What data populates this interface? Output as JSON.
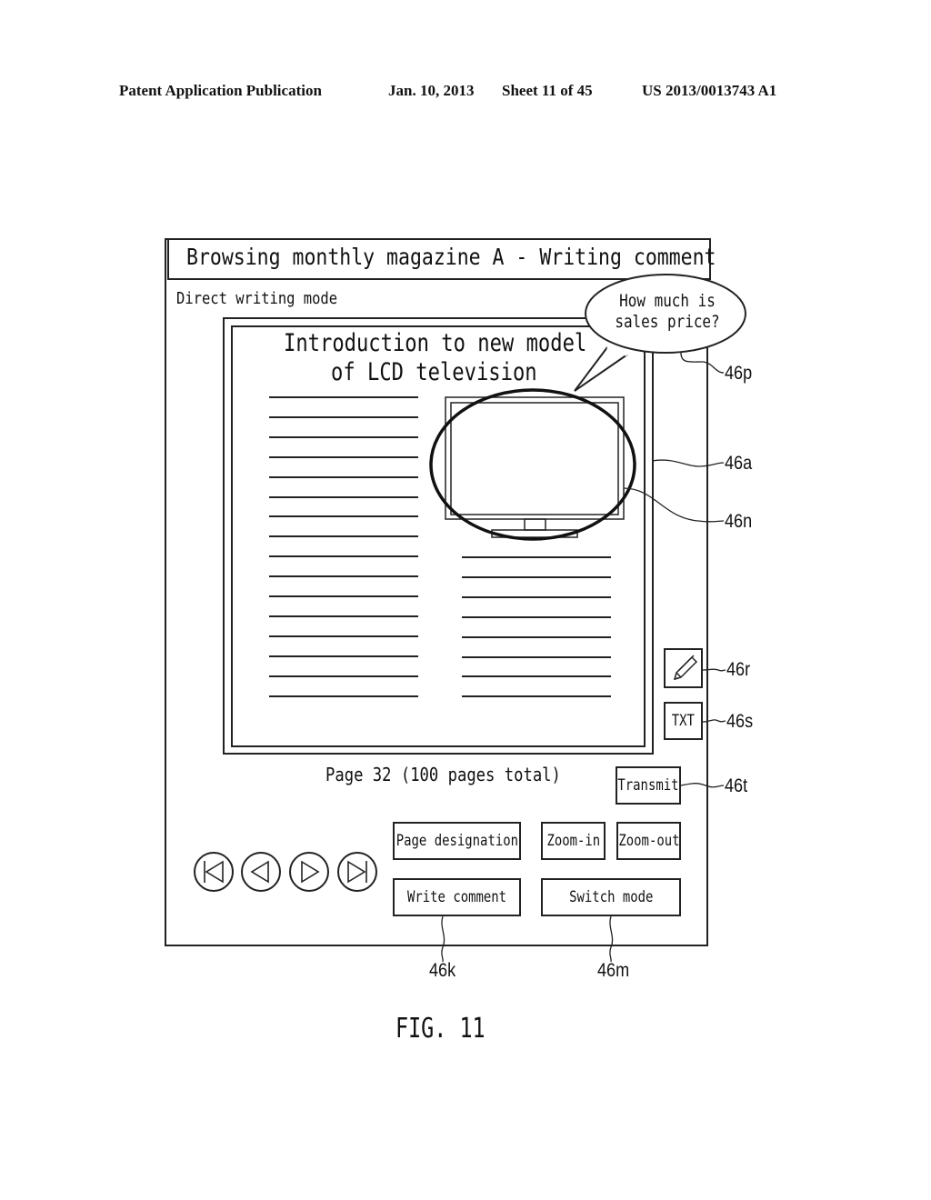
{
  "patent_header": {
    "publication": "Patent Application Publication",
    "date": "Jan. 10, 2013",
    "sheet": "Sheet 11 of 45",
    "number": "US 2013/0013743 A1"
  },
  "screen": {
    "title": "Browsing monthly magazine A - Writing comment",
    "mode_label": "Direct writing mode",
    "page": {
      "headline_line1": "Introduction to new model",
      "headline_line2": "of LCD television",
      "image": "lcd-television",
      "left_column_lines": 16,
      "right_column_lines": 8
    },
    "comment_bubble": {
      "line1": "How much is",
      "line2": "sales price?"
    },
    "page_info": "Page 32 (100 pages total)",
    "tools": {
      "pen_icon": "pencil-icon",
      "text_button": "TXT",
      "transmit_button": "Transmit"
    },
    "navigation": {
      "first": "skip-to-first-icon",
      "prev": "previous-icon",
      "next": "next-icon",
      "last": "skip-to-last-icon"
    },
    "buttons": {
      "page_designation": "Page designation",
      "zoom_in": "Zoom-in",
      "zoom_out": "Zoom-out",
      "write_comment": "Write comment",
      "switch_mode": "Switch mode"
    }
  },
  "reference_labels": {
    "p": "46p",
    "a": "46a",
    "n": "46n",
    "r": "46r",
    "s": "46s",
    "t": "46t",
    "k": "46k",
    "m": "46m"
  },
  "figure_label": "FIG. 11"
}
